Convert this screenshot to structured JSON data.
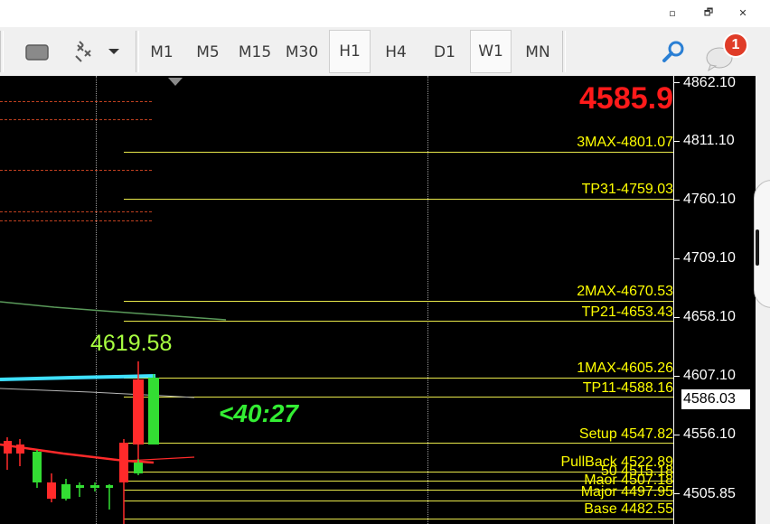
{
  "window_controls": {
    "minimize": "▫",
    "restore": "🗗",
    "close": "✕"
  },
  "toolbar": {
    "timeframes": [
      "M1",
      "M5",
      "M15",
      "M30",
      "H1",
      "H4",
      "D1",
      "W1",
      "MN"
    ],
    "active_timeframes": [
      "H1",
      "W1"
    ],
    "notification_count": "1"
  },
  "chart": {
    "big_price": "4585.9",
    "high_label": "4619.58",
    "countdown": "<40:27",
    "levels": [
      {
        "label": "3MAX-4801.07",
        "price": 4801.07
      },
      {
        "label": "TP31-4759.03",
        "price": 4759.03
      },
      {
        "label": "2MAX-4670.53",
        "price": 4670.53
      },
      {
        "label": "TP21-4653.43",
        "price": 4653.43
      },
      {
        "label": "1MAX-4605.26",
        "price": 4605.26
      },
      {
        "label": "TP11-4588.16",
        "price": 4588.16
      },
      {
        "label": "Setup 4547.82",
        "price": 4547.82
      },
      {
        "label": "PullBack 4522.89",
        "price": 4522.89
      },
      {
        "label": "50 4515.18",
        "price": 4515.18
      },
      {
        "label": "Maor 4507.18",
        "price": 4507.18
      },
      {
        "label": "Major 4497.95",
        "price": 4497.95
      },
      {
        "label": "Base 4482.55",
        "price": 4482.55
      }
    ],
    "price_axis": [
      "4862.10",
      "4811.10",
      "4760.10",
      "4709.10",
      "4658.10",
      "4607.10",
      "4556.10",
      "4505.85"
    ],
    "current_price": "4586.03",
    "colors": {
      "background": "#000000",
      "level_line": "#e8e84a",
      "level_text": "#ffff00",
      "big_price": "#ff1a1a",
      "high_label": "#a8ff40",
      "countdown": "#33ee33",
      "bull": "#33dd33",
      "bear": "#ff2a2a",
      "ma_cyan": "#3ee0ff"
    }
  }
}
